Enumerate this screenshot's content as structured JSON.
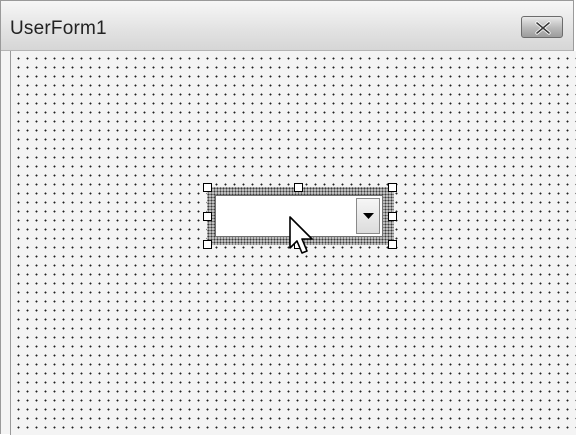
{
  "window": {
    "title": "UserForm1",
    "close_icon": "close-x-icon"
  },
  "combobox": {
    "value": "",
    "dropdown_icon": "chevron-down-icon"
  },
  "cursor_icon": "mouse-pointer-icon",
  "colors": {
    "form_background": "#f4f4f4",
    "grid_dot": "#202020",
    "selection_hatch": "#bdbdbd"
  }
}
